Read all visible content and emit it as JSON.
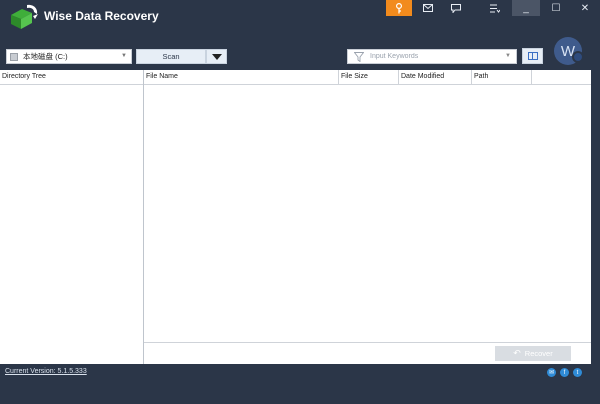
{
  "app": {
    "title": "Wise Data Recovery",
    "accent_color": "#f28b1d",
    "bg_color": "#2b3648"
  },
  "titlebar_buttons": {
    "key_icon": "key-icon",
    "mail_icon": "mail-icon",
    "chat_icon": "chat-icon",
    "menu_icon": "menu-icon",
    "minimize_glyph": "_",
    "maximize_glyph": "☐",
    "close_glyph": "✕"
  },
  "toolbar": {
    "drive_selected": "本地磁盘 (C:)",
    "scan_label": "Scan",
    "search_placeholder": "Input Keywords",
    "avatar_letter": "W"
  },
  "tree": {
    "header": "Directory Tree"
  },
  "file_table": {
    "columns": [
      "File Name",
      "File Size",
      "Date Modified",
      "Path"
    ],
    "rows": []
  },
  "actions": {
    "recover_label": "Recover"
  },
  "status": {
    "version_text": "Current Version: 5.1.5.333"
  },
  "social": {
    "mail": "✉",
    "facebook": "f",
    "twitter": "t"
  }
}
